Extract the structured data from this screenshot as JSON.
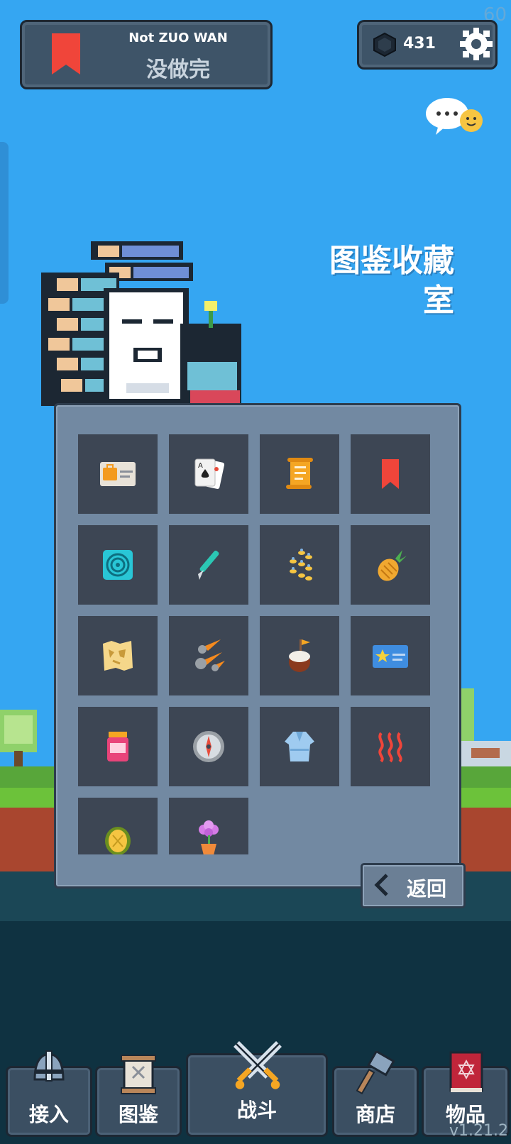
{
  "hud": {
    "fps": "60",
    "version": "v1.21.2"
  },
  "title_panel": {
    "english": "Not ZUO WAN",
    "chinese": "没做完"
  },
  "currency": {
    "gems": "431"
  },
  "room": {
    "title_line1": "图鉴收藏",
    "title_line2": "室"
  },
  "collection": {
    "items": [
      {
        "icon": "briefcase-card-icon"
      },
      {
        "icon": "playing-cards-icon"
      },
      {
        "icon": "scroll-icon"
      },
      {
        "icon": "red-bookmark-icon"
      },
      {
        "icon": "spiral-target-icon"
      },
      {
        "icon": "scalpel-icon"
      },
      {
        "icon": "bee-swarm-icon"
      },
      {
        "icon": "pineapple-icon"
      },
      {
        "icon": "treasure-map-icon"
      },
      {
        "icon": "meteors-icon"
      },
      {
        "icon": "cake-flag-icon"
      },
      {
        "icon": "star-card-icon"
      },
      {
        "icon": "jam-jar-icon"
      },
      {
        "icon": "compass-icon"
      },
      {
        "icon": "bathrobe-icon"
      },
      {
        "icon": "heat-waves-icon"
      },
      {
        "icon": "durian-icon"
      },
      {
        "icon": "potted-flower-icon"
      }
    ]
  },
  "back_button": {
    "label": "返回"
  },
  "nav": {
    "join": "接入",
    "codex": "图鉴",
    "battle": "战斗",
    "shop": "商店",
    "items": "物品"
  },
  "colors": {
    "sky": "#35a6f2",
    "panel": "#7289a2",
    "cell": "#3d4654",
    "nav": "#3b4f62"
  }
}
